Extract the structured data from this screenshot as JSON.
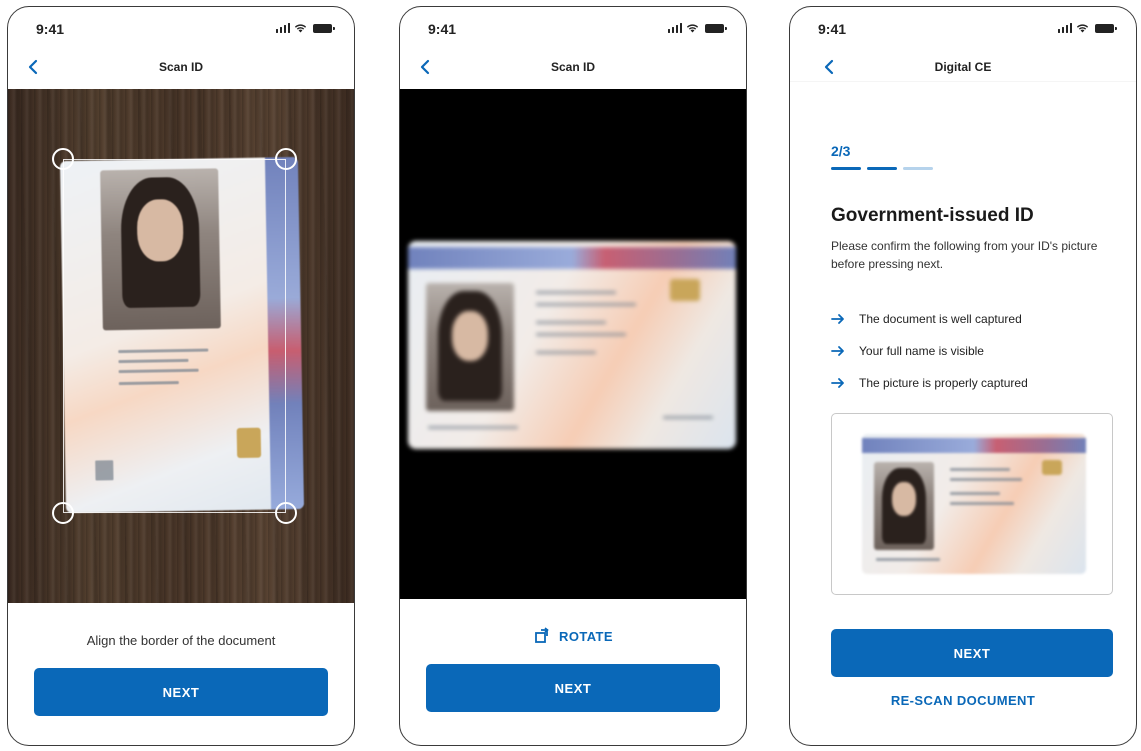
{
  "status": {
    "time": "9:41"
  },
  "screen1": {
    "nav_title": "Scan ID",
    "instruction": "Align the border of the document",
    "next_label": "NEXT"
  },
  "screen2": {
    "nav_title": "Scan ID",
    "rotate_label": "ROTATE",
    "next_label": "NEXT"
  },
  "screen3": {
    "nav_title": "Digital CE",
    "step_counter": "2/3",
    "title": "Government-issued ID",
    "subtitle": "Please confirm the following from your ID's picture before pressing next.",
    "checklist": [
      "The document is well captured",
      "Your full name is visible",
      "The picture is properly captured"
    ],
    "next_label": "NEXT",
    "rescan_label": "RE-SCAN DOCUMENT"
  },
  "colors": {
    "accent": "#0a68b8",
    "progress_inactive": "#b6d3ec"
  }
}
